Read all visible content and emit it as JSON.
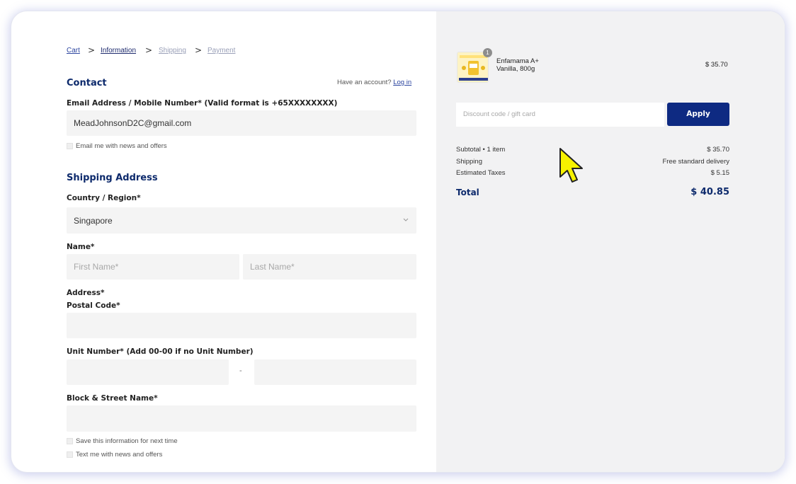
{
  "breadcrumb": {
    "cart": "Cart",
    "information": "Information",
    "shipping": "Shipping",
    "payment": "Payment",
    "separator": ">"
  },
  "contact": {
    "heading": "Contact",
    "account_prompt": "Have an account?",
    "login_link": "Log in",
    "email_label": "Email Address / Mobile Number* (Valid format is +65XXXXXXXX)",
    "email_value": "MeadJohnsonD2C@gmail.com",
    "newsletter_label": "Email me with news and offers"
  },
  "shipping_address": {
    "heading": "Shipping Address",
    "country_label": "Country / Region*",
    "country_value": "Singapore",
    "name_label": "Name*",
    "first_name_placeholder": "First Name*",
    "last_name_placeholder": "Last Name*",
    "address_label": "Address*",
    "postal_label": "Postal Code*",
    "unit_label": "Unit Number* (Add 00-00 if no Unit Number)",
    "unit_separator": "-",
    "street_label": "Block & Street Name*",
    "save_info_label": "Save this information for next time",
    "sms_label": "Text me with news and offers"
  },
  "order_summary": {
    "item": {
      "name_line1": "Enfamama A+",
      "name_line2": "Vanilla, 800g",
      "quantity": "1",
      "price": "$ 35.70"
    },
    "discount_placeholder": "Discount code / gift card",
    "apply_label": "Apply",
    "subtotal_label": "Subtotal • 1 item",
    "subtotal_value": "$ 35.70",
    "shipping_label": "Shipping",
    "shipping_value": "Free standard delivery",
    "taxes_label": "Estimated Taxes",
    "taxes_value": "$ 5.15",
    "total_label": "Total",
    "total_value": "$ 40.85"
  },
  "colors": {
    "brand_navy": "#0d2a6c",
    "button_blue": "#0e2a82",
    "panel_gray": "#f2f2f3",
    "cursor_yellow": "#f7f200"
  }
}
